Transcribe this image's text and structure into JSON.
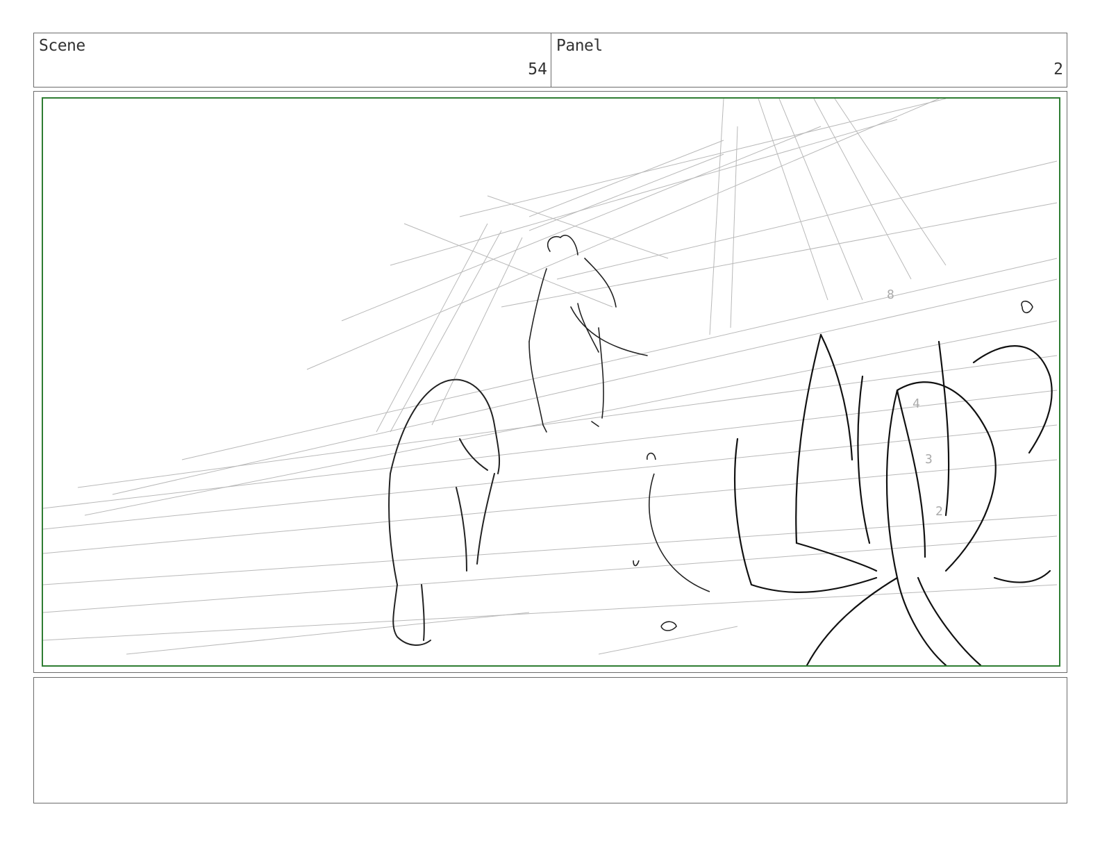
{
  "header": {
    "scene_label": "Scene",
    "scene_number": "54",
    "panel_label": "Panel",
    "panel_number": "2"
  },
  "sketch": {
    "stroke_color": "#222222",
    "guide_color": "#b8b8b8",
    "frame_color": "#2e7d32",
    "petal_numbers": [
      "8",
      "4",
      "3",
      "2"
    ]
  },
  "notes": {
    "text": ""
  }
}
